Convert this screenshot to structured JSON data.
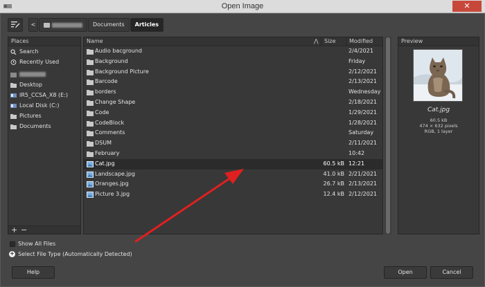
{
  "window": {
    "title": "Open Image",
    "close_glyph": "✕"
  },
  "toolbar": {
    "back_glyph": "<",
    "breadcrumbs": [
      "Documents",
      "Articles"
    ],
    "active_crumb": "Articles"
  },
  "places": {
    "header": "Places",
    "items": [
      {
        "label": "Search",
        "icon": "search-icon"
      },
      {
        "label": "Recently Used",
        "icon": "recent-icon"
      },
      {
        "label": "Desktop",
        "icon": "folder-icon"
      },
      {
        "label": "IR5_CCSA_X8 (E:)",
        "icon": "drive-icon"
      },
      {
        "label": "Local Disk (C:)",
        "icon": "drive-icon"
      },
      {
        "label": "Pictures",
        "icon": "folder-icon"
      },
      {
        "label": "Documents",
        "icon": "folder-icon"
      }
    ],
    "add_glyph": "+",
    "remove_glyph": "−"
  },
  "files": {
    "columns": {
      "name": "Name",
      "size": "Size",
      "modified": "Modified",
      "sort_glyph": "⋀"
    },
    "rows": [
      {
        "name": "Audio bacground",
        "size": "",
        "modified": "2/4/2021",
        "type": "folder"
      },
      {
        "name": "Background",
        "size": "",
        "modified": "Friday",
        "type": "folder"
      },
      {
        "name": "Background Picture",
        "size": "",
        "modified": "2/12/2021",
        "type": "folder"
      },
      {
        "name": "Barcode",
        "size": "",
        "modified": "2/13/2021",
        "type": "folder"
      },
      {
        "name": "borders",
        "size": "",
        "modified": "Wednesday",
        "type": "folder"
      },
      {
        "name": "Change Shape",
        "size": "",
        "modified": "2/18/2021",
        "type": "folder"
      },
      {
        "name": "Code",
        "size": "",
        "modified": "1/29/2021",
        "type": "folder"
      },
      {
        "name": "CodeBlock",
        "size": "",
        "modified": "1/28/2021",
        "type": "folder"
      },
      {
        "name": "Comments",
        "size": "",
        "modified": "Saturday",
        "type": "folder"
      },
      {
        "name": "DSUM",
        "size": "",
        "modified": "2/11/2021",
        "type": "folder"
      },
      {
        "name": "February",
        "size": "",
        "modified": "10:42",
        "type": "folder"
      },
      {
        "name": "Cat.jpg",
        "size": "60.5 kB",
        "modified": "12:21",
        "type": "image",
        "selected": true
      },
      {
        "name": "Landscape.jpg",
        "size": "41.0 kB",
        "modified": "2/21/2021",
        "type": "image"
      },
      {
        "name": "Oranges.jpg",
        "size": "26.7 kB",
        "modified": "2/13/2021",
        "type": "image"
      },
      {
        "name": "Picture 3.jpg",
        "size": "12.4 kB",
        "modified": "2/12/2021",
        "type": "image"
      }
    ]
  },
  "preview": {
    "header": "Preview",
    "filename": "Cat.jpg",
    "size": "60.5 kB",
    "dimensions": "474 × 632 pixels",
    "mode": "RGB, 1 layer"
  },
  "options": {
    "show_all_files": "Show All Files",
    "select_file_type": "Select File Type (Automatically Detected)",
    "expander_glyph": "+"
  },
  "buttons": {
    "help": "Help",
    "open": "Open",
    "cancel": "Cancel"
  },
  "colors": {
    "annotation_arrow": "#e02020",
    "close_button": "#c7483b"
  }
}
